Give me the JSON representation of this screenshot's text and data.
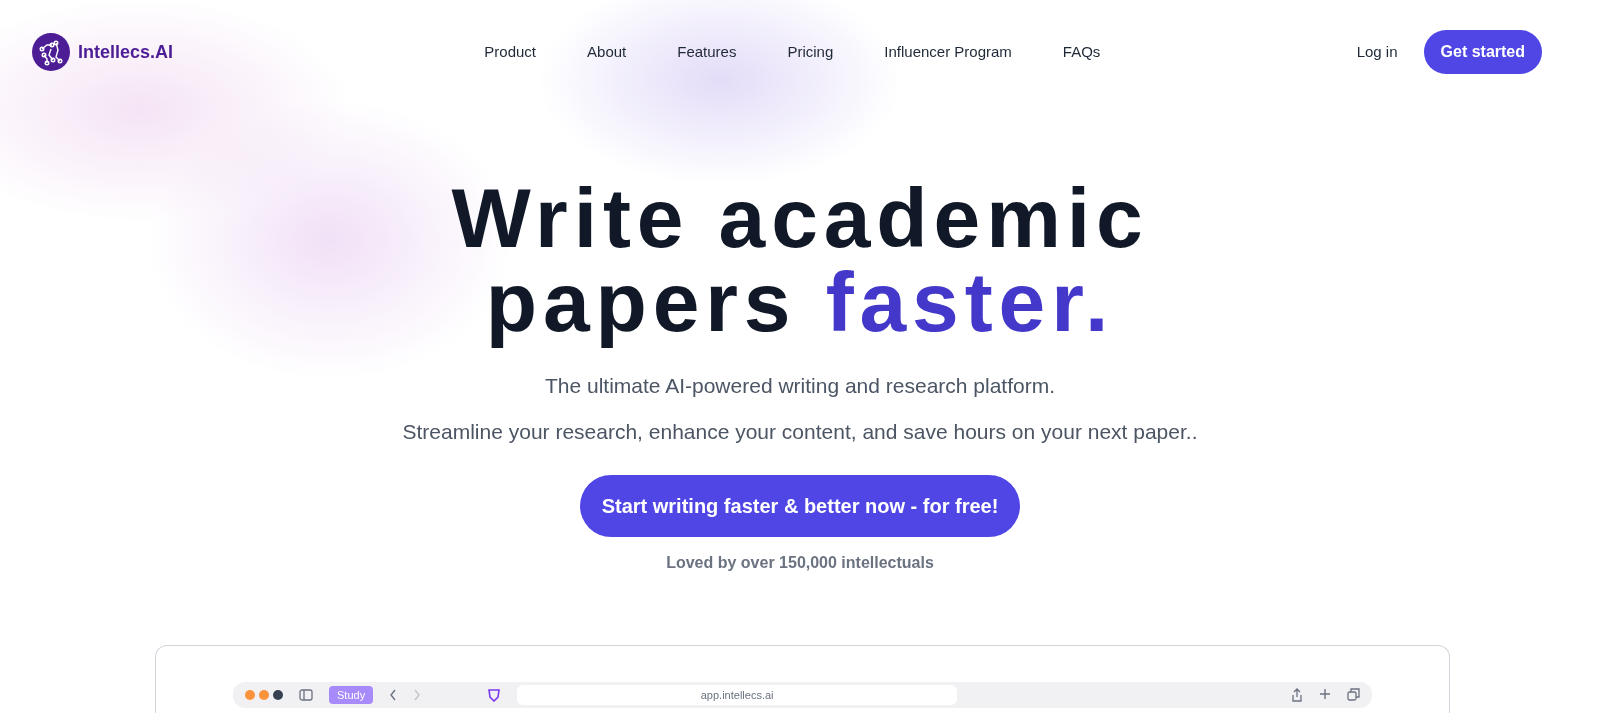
{
  "logo": {
    "text": "Intellecs.AI"
  },
  "nav": [
    {
      "label": "Product"
    },
    {
      "label": "About"
    },
    {
      "label": "Features"
    },
    {
      "label": "Pricing"
    },
    {
      "label": "Influencer Program"
    },
    {
      "label": "FAQs"
    }
  ],
  "login": "Log in",
  "get_started": "Get started",
  "hero": {
    "title": "Write academic papers",
    "title_highlight": "faster.",
    "subtitle": "The ultimate AI-powered writing and research platform.",
    "tagline": "Streamline your research, enhance your content, and save hours on your next paper..",
    "cta": "Start writing faster & better now - for free!",
    "social_proof": "Loved by over 150,000 intellectuals"
  },
  "browser": {
    "tab": "Study",
    "address": "app.intellecs.ai"
  }
}
